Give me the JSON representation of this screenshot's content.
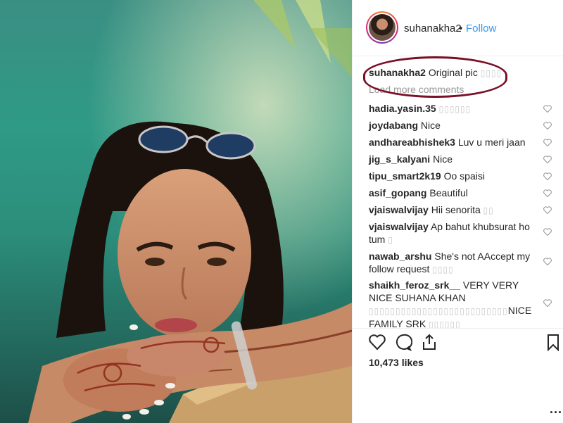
{
  "post": {
    "username": "suhanakha2",
    "separator": "•",
    "follow_label": "Follow",
    "caption": {
      "username": "suhanakha2",
      "text": "Original pic",
      "emoji": "▯▯▯▯"
    },
    "load_more": "Load more comments",
    "likes": "10,473 likes",
    "more_label": "...",
    "highlight_color": "#7a1026",
    "accent_color": "#3897f0"
  },
  "comments": [
    {
      "username": "hadia.yasin.35",
      "text": "",
      "emoji": "▯▯▯▯▯▯"
    },
    {
      "username": "joydabang",
      "text": "Nice",
      "emoji": ""
    },
    {
      "username": "andhareabhishek3",
      "text": "Luv u meri jaan",
      "emoji": ""
    },
    {
      "username": "jig_s_kalyani",
      "text": "Nice",
      "emoji": ""
    },
    {
      "username": "tipu_smart2k19",
      "text": "Oo spaisi",
      "emoji": ""
    },
    {
      "username": "asif_gopang",
      "text": "Beautiful",
      "emoji": ""
    },
    {
      "username": "vjaiswalvijay",
      "text": "Hii senorita",
      "emoji": "▯▯"
    },
    {
      "username": "vjaiswalvijay",
      "text": "Ap bahut khubsurat ho tum",
      "emoji": "▯"
    },
    {
      "username": "nawab_arshu",
      "text": "She's not AAccept my follow request",
      "emoji": "▯▯▯▯"
    },
    {
      "username": "shaikh_feroz_srk__",
      "text": "VERY VERY NICE SUHANA KHAN",
      "emoji": "▯▯▯▯▯▯▯▯▯▯▯▯▯▯▯▯▯▯▯▯▯▯▯▯▯▯",
      "tail": "NICE FAMILY SRK",
      "tail_emoji": "▯▯▯▯▯▯"
    }
  ],
  "icons": {
    "like": "heart-outline-icon",
    "comment": "comment-bubble-icon",
    "share": "share-icon",
    "save": "bookmark-icon",
    "comment_like": "heart-icon"
  }
}
